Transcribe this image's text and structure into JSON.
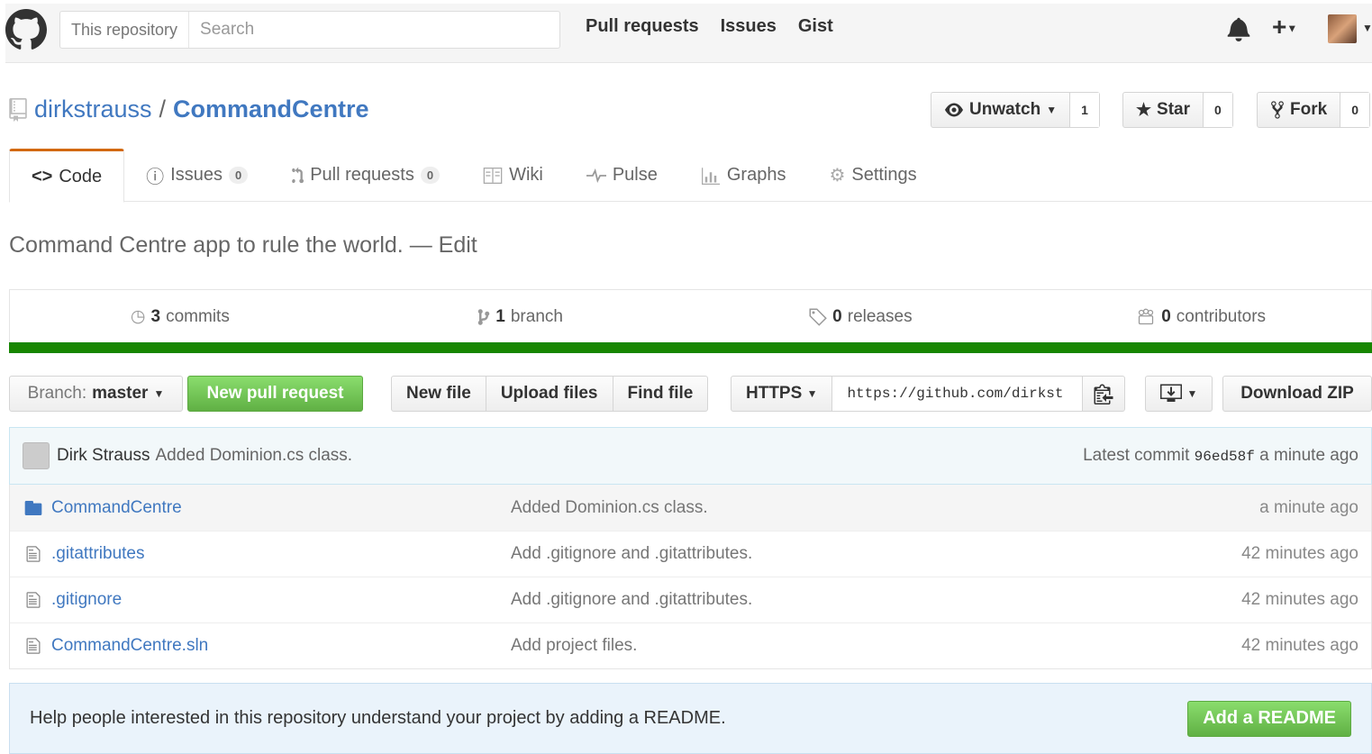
{
  "header": {
    "search_scope": "This repository",
    "search_placeholder": "Search",
    "nav": [
      "Pull requests",
      "Issues",
      "Gist"
    ],
    "plus_label": "+"
  },
  "repo": {
    "owner": "dirkstrauss",
    "separator": "/",
    "name": "CommandCentre",
    "watch_label": "Unwatch",
    "watch_count": "1",
    "star_label": "Star",
    "star_count": "0",
    "fork_label": "Fork",
    "fork_count": "0"
  },
  "tabs": [
    {
      "label": "Code",
      "icon": "code-icon"
    },
    {
      "label": "Issues",
      "counter": "0",
      "icon": "issue-icon"
    },
    {
      "label": "Pull requests",
      "counter": "0",
      "icon": "pull-request-icon"
    },
    {
      "label": "Wiki",
      "icon": "wiki-icon"
    },
    {
      "label": "Pulse",
      "icon": "pulse-icon"
    },
    {
      "label": "Graphs",
      "icon": "graph-icon"
    },
    {
      "label": "Settings",
      "icon": "gear-icon"
    }
  ],
  "description": {
    "text": "Command Centre app to rule the world.",
    "dash": "—",
    "edit": "Edit"
  },
  "summary": [
    {
      "num": "3",
      "label": "commits",
      "icon": "history-icon"
    },
    {
      "num": "1",
      "label": "branch",
      "icon": "branch-icon"
    },
    {
      "num": "0",
      "label": "releases",
      "icon": "tag-icon"
    },
    {
      "num": "0",
      "label": "contributors",
      "icon": "organization-icon"
    }
  ],
  "language_color": "#178600",
  "filenav": {
    "branch_prefix": "Branch:",
    "branch": "master",
    "new_pr": "New pull request",
    "new_file": "New file",
    "upload": "Upload files",
    "find": "Find file",
    "protocol": "HTTPS",
    "clone_url": "https://github.com/dirkst",
    "download": "Download ZIP"
  },
  "latest_commit": {
    "author": "Dirk Strauss",
    "message": "Added Dominion.cs class.",
    "prefix": "Latest commit",
    "sha": "96ed58f",
    "age": "a minute ago"
  },
  "files": [
    {
      "type": "folder",
      "name": "CommandCentre",
      "message": "Added Dominion.cs class.",
      "age": "a minute ago"
    },
    {
      "type": "file",
      "name": ".gitattributes",
      "message": "Add .gitignore and .gitattributes.",
      "age": "42 minutes ago"
    },
    {
      "type": "file",
      "name": ".gitignore",
      "message": "Add .gitignore and .gitattributes.",
      "age": "42 minutes ago"
    },
    {
      "type": "file",
      "name": "CommandCentre.sln",
      "message": "Add project files.",
      "age": "42 minutes ago"
    }
  ],
  "readme": {
    "text": "Help people interested in this repository understand your project by adding a README.",
    "button": "Add a README"
  }
}
